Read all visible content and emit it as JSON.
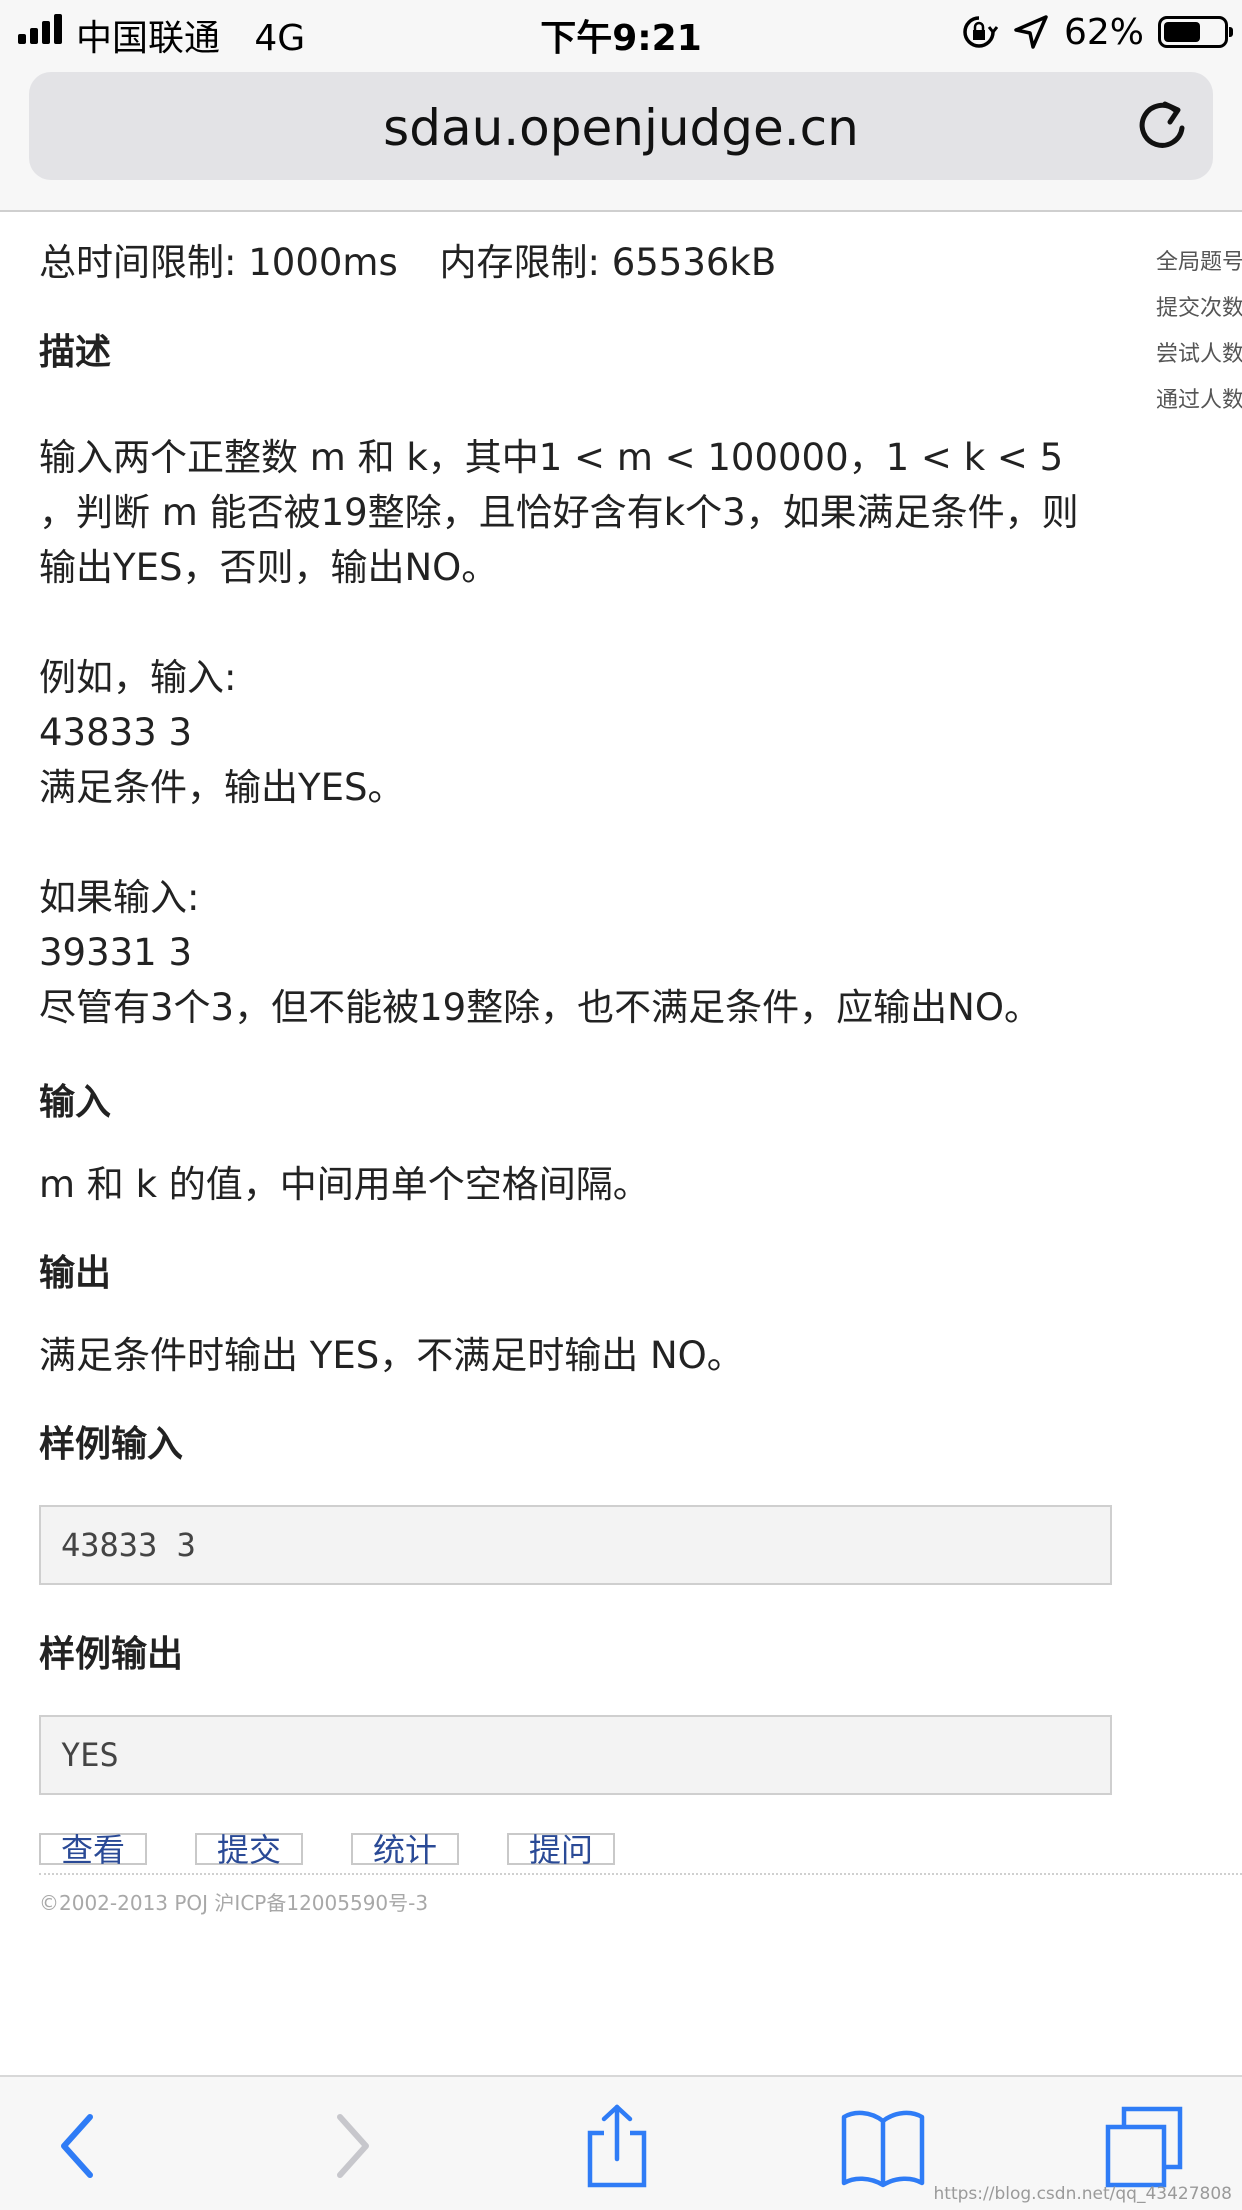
{
  "status_bar": {
    "carrier": "中国联通",
    "network": "4G",
    "time": "下午9:21",
    "battery_percent": "62%",
    "battery_level": 0.62
  },
  "browser": {
    "url": "sdau.openjudge.cn",
    "icons": [
      "reload-icon",
      "back-icon",
      "forward-icon",
      "share-icon",
      "bookmarks-icon",
      "tabs-icon"
    ]
  },
  "problem": {
    "time_limit_label": "总时间限制:",
    "time_limit_value": "1000ms",
    "memory_limit_label": "内存限制:",
    "memory_limit_value": "65536kB",
    "description_title": "描述",
    "description_lines": [
      "输入两个正整数 m 和 k，其中1 < m < 100000，1 < k < 5",
      "，判断 m 能否被19整除，且恰好含有k个3，如果满足条件，则",
      "输出YES，否则，输出NO。"
    ],
    "example1_lines": [
      "例如，输入:",
      "43833 3",
      "满足条件，输出YES。"
    ],
    "example2_lines": [
      "如果输入:",
      "39331 3",
      "尽管有3个3，但不能被19整除，也不满足条件，应输出NO。"
    ],
    "input_title": "输入",
    "input_text": "m 和 k 的值，中间用单个空格间隔。",
    "output_title": "输出",
    "output_text": "满足条件时输出 YES，不满足时输出 NO。",
    "sample_input_title": "样例输入",
    "sample_input": "43833 3",
    "sample_output_title": "样例输出",
    "sample_output": "YES"
  },
  "actions": [
    "查看",
    "提交",
    "统计",
    "提问"
  ],
  "footer": "©2002-2013 POJ 沪ICP备12005590号-3",
  "side_panel": [
    "全局题号",
    "提交次数",
    "尝试人数",
    "通过人数"
  ],
  "watermark": "https://blog.csdn.net/qq_43427808",
  "colors": {
    "link_blue": "#2a4a96",
    "toolbar_blue": "#2f7cf6",
    "toolbar_disabled": "#c7c7cc"
  }
}
